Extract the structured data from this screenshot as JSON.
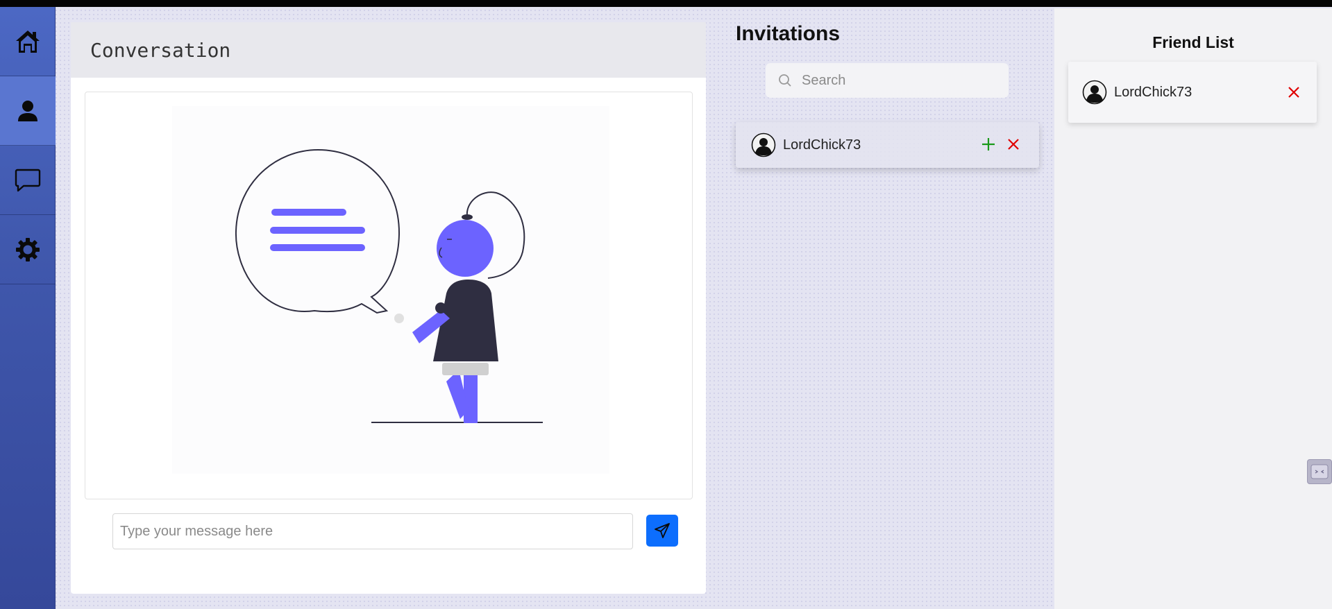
{
  "sidebar": {
    "items": [
      {
        "icon": "home-icon"
      },
      {
        "icon": "user-icon",
        "active": true
      },
      {
        "icon": "chat-icon"
      },
      {
        "icon": "gear-icon"
      }
    ]
  },
  "conversation": {
    "title": "Conversation",
    "message_placeholder": "Type your message here",
    "send_icon": "send-icon"
  },
  "invitations": {
    "title": "Invitations",
    "search_placeholder": "Search",
    "items": [
      {
        "username": "LordChick73",
        "accept_icon": "plus-icon",
        "decline_icon": "close-icon"
      }
    ]
  },
  "friends": {
    "title": "Friend List",
    "items": [
      {
        "username": "LordChick73",
        "remove_icon": "close-icon"
      }
    ]
  },
  "colors": {
    "sidebar_top": "#4c68c4",
    "sidebar_bottom": "#35489a",
    "accent": "#0d6efd",
    "illustration": "#6c63ff",
    "accept": "#1a9a1a",
    "decline": "#e00000"
  }
}
